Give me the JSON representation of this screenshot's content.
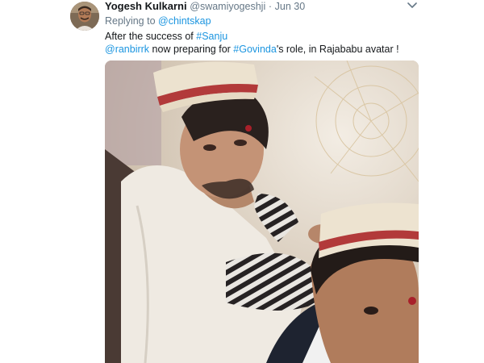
{
  "tweet": {
    "author_name": "Yogesh Kulkarni",
    "author_handle": "@swamiyogeshji",
    "separator": "·",
    "timestamp": "Jun 30",
    "replying_prefix": "Replying to",
    "replying_handle": "@chintskap",
    "line1_text": "After the success of ",
    "line1_hashtag": "#Sanju",
    "line2_mention": "@ranbirrk",
    "line2_text_a": " now preparing for ",
    "line2_hashtag": "#Govinda",
    "line2_text_b": "'s role, in Rajababu avatar !"
  },
  "icons": {
    "caret": "chevron-down-icon"
  },
  "colors": {
    "link": "#1b95e0",
    "secondary_text": "#657786",
    "primary_text": "#14171a"
  }
}
